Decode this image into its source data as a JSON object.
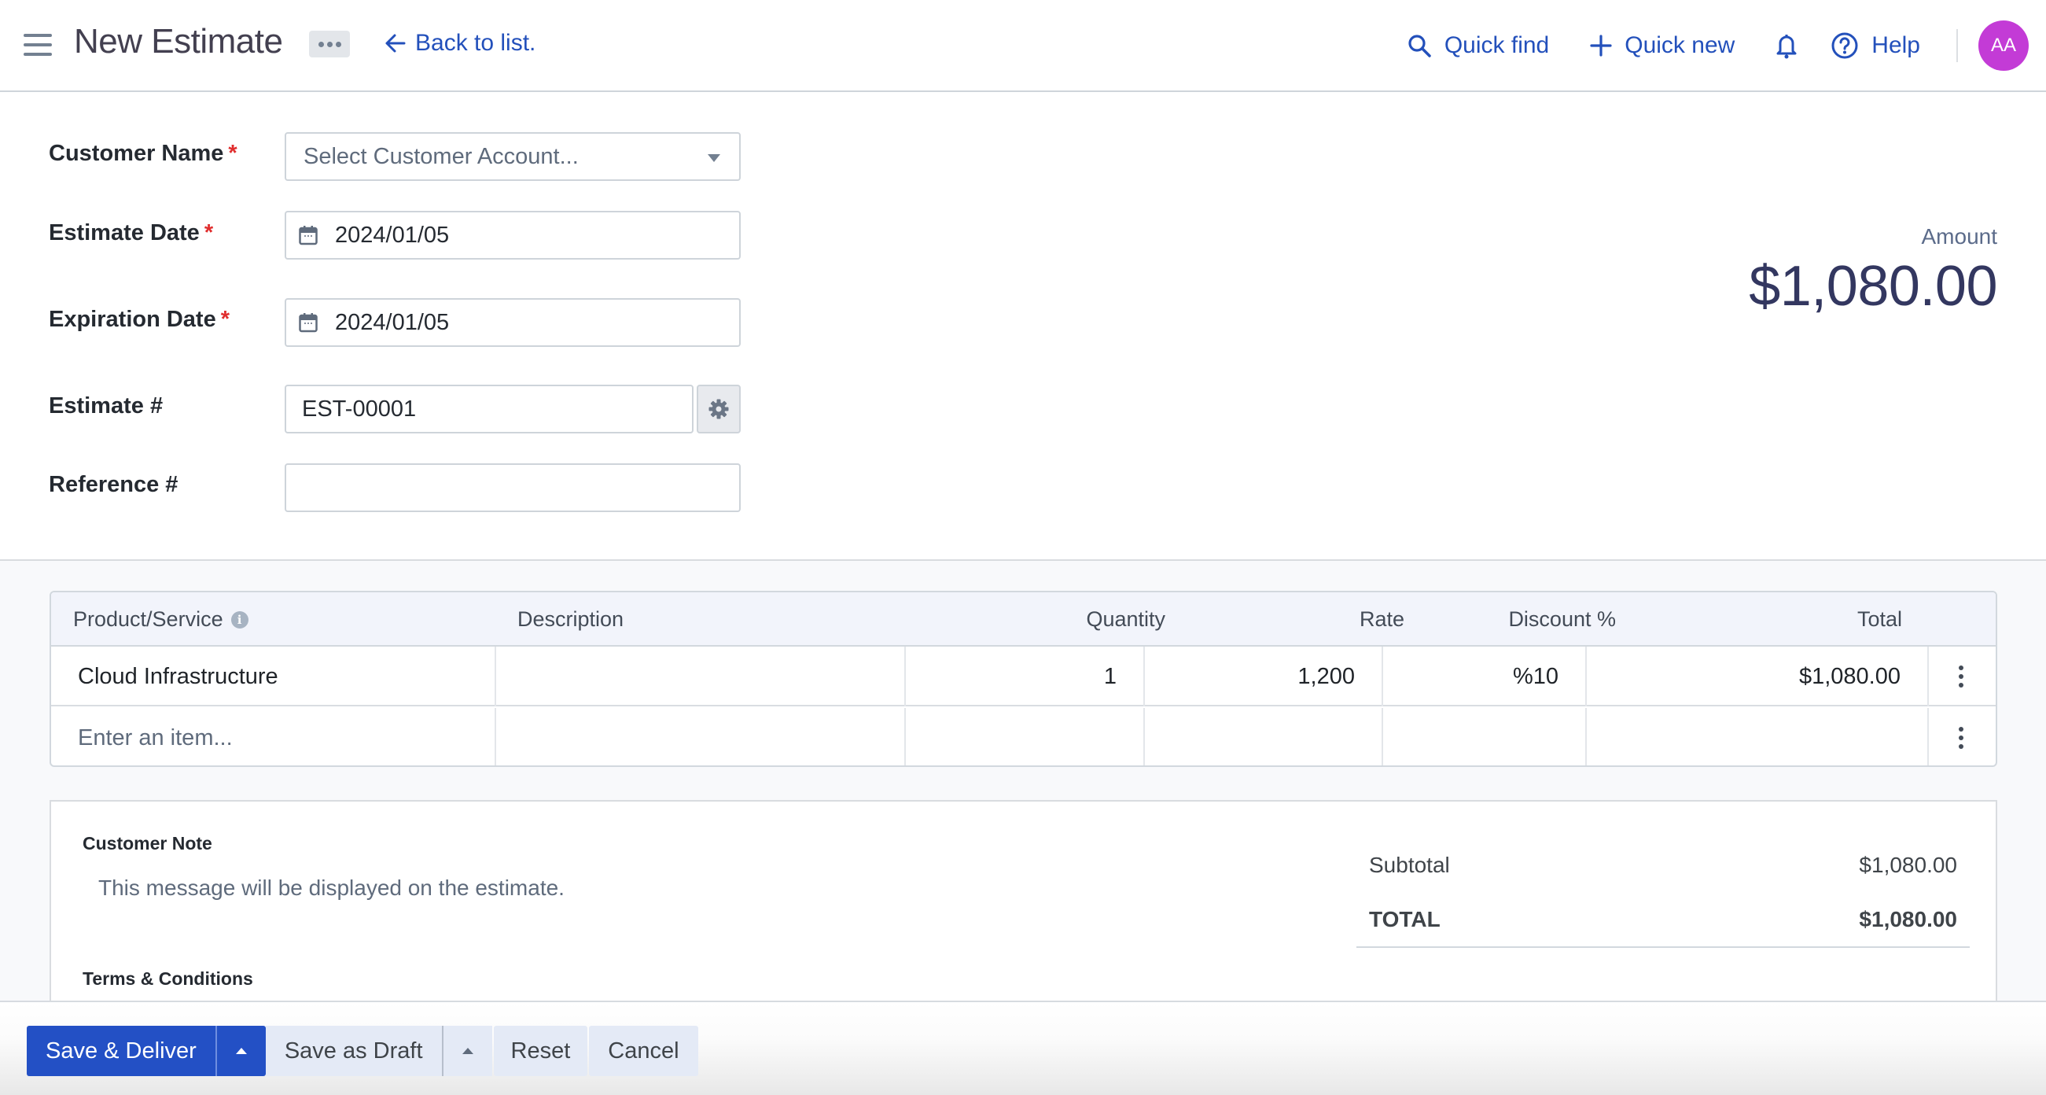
{
  "header": {
    "title": "New Estimate",
    "back_link": "Back to list.",
    "quick_find": "Quick find",
    "quick_new": "Quick new",
    "help": "Help",
    "avatar_initials": "AA",
    "accent_color": "#2350bb",
    "avatar_color": "#c33bd6"
  },
  "form": {
    "customer_name": {
      "label": "Customer Name",
      "required": "*",
      "placeholder": "Select Customer Account..."
    },
    "estimate_date": {
      "label": "Estimate Date",
      "required": "*",
      "value": "2024/01/05"
    },
    "expiration_date": {
      "label": "Expiration Date",
      "required": "*",
      "value": "2024/01/05"
    },
    "estimate_number": {
      "label": "Estimate #",
      "value": "EST-00001"
    },
    "reference_number": {
      "label": "Reference #",
      "value": ""
    }
  },
  "amount": {
    "label": "Amount",
    "value": "$1,080.00"
  },
  "items_table": {
    "columns": [
      "Product/Service",
      "Description",
      "Quantity",
      "Rate",
      "Discount %",
      "Total"
    ],
    "rows": [
      {
        "product": "Cloud Infrastructure",
        "description": "",
        "quantity": "1",
        "rate": "1,200",
        "discount": "%10",
        "total": "$1,080.00"
      }
    ],
    "new_item_placeholder": "Enter an item..."
  },
  "footer": {
    "customer_note_label": "Customer Note",
    "customer_note_placeholder": "This message will be displayed on the estimate.",
    "terms_label": "Terms & Conditions",
    "subtotal_label": "Subtotal",
    "subtotal_value": "$1,080.00",
    "total_label": "TOTAL",
    "total_value": "$1,080.00"
  },
  "actions": {
    "save_deliver": "Save & Deliver",
    "save_draft": "Save as Draft",
    "reset": "Reset",
    "cancel": "Cancel",
    "primary_color": "#2350c5"
  }
}
